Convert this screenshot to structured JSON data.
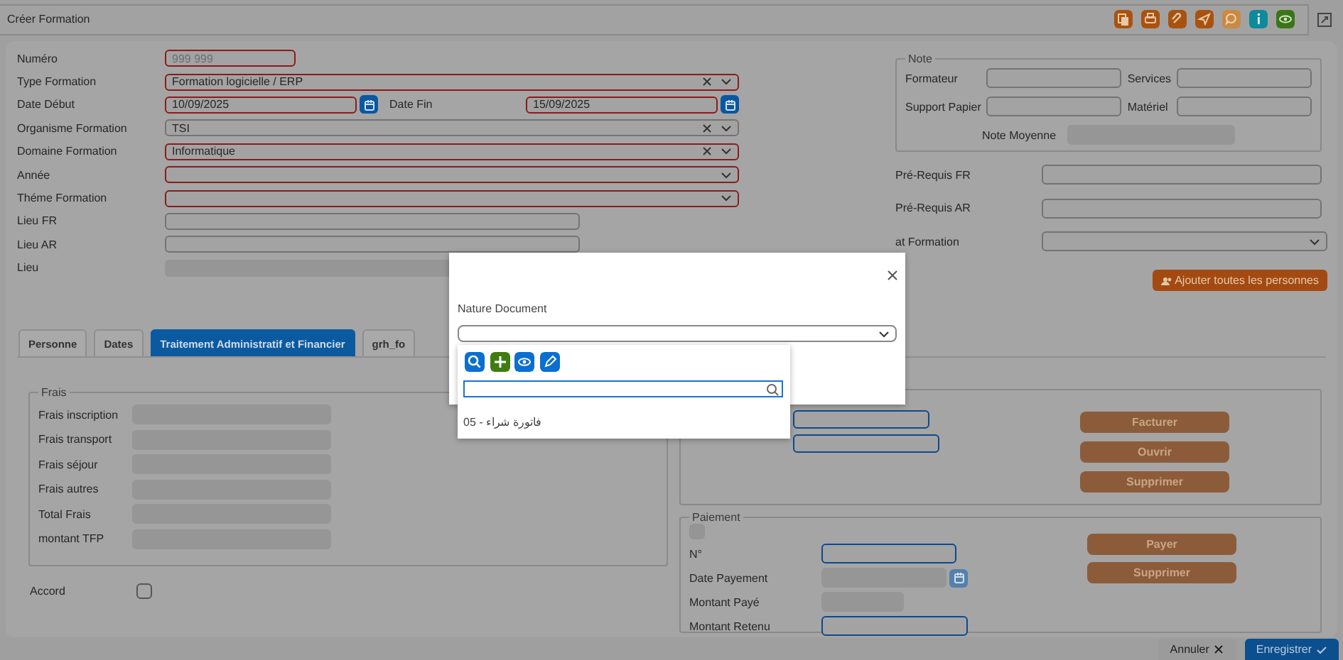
{
  "window": {
    "title": "Créer Formation"
  },
  "toolbar": [
    {
      "kind": "documents"
    },
    {
      "kind": "print"
    },
    {
      "kind": "attach"
    },
    {
      "kind": "send"
    },
    {
      "kind": "comment"
    },
    {
      "kind": "info"
    },
    {
      "kind": "view"
    }
  ],
  "form": [
    {
      "label": "Numéro",
      "kind": "number",
      "placeholder": "999 999",
      "required": true
    },
    {
      "label": "Type Formation",
      "kind": "select",
      "value": "Formation logicielle / ERP",
      "required": true,
      "clearable": true
    },
    {
      "kind": "date_pair",
      "fields": [
        {
          "label": "Date Début",
          "value": "10/09/2025",
          "required": true
        },
        {
          "label": "Date Fin",
          "value": "15/09/2025",
          "required": true
        }
      ]
    },
    {
      "label": "Organisme Formation",
      "kind": "select",
      "value": "TSI",
      "required": false,
      "clearable": true
    },
    {
      "label": "Domaine Formation",
      "kind": "select",
      "value": "Informatique",
      "required": true,
      "clearable": true
    },
    {
      "label": "Année",
      "kind": "select",
      "required": true,
      "clearable": false
    },
    {
      "label": "Théme Formation",
      "kind": "select",
      "required": true,
      "clearable": false
    },
    {
      "label": "Lieu FR",
      "kind": "text",
      "disabled": false
    },
    {
      "label": "Lieu AR",
      "kind": "text",
      "disabled": false
    },
    {
      "label": "Lieu",
      "kind": "text",
      "disabled": true
    }
  ],
  "note": {
    "legend": "Note",
    "fields": [
      {
        "label": "Formateur"
      },
      {
        "label": "Services"
      },
      {
        "label": "Support Papier"
      },
      {
        "label": "Matériel"
      }
    ],
    "average": {
      "label": "Note Moyenne"
    }
  },
  "side_fields": [
    {
      "label": "Pré-Requis FR",
      "kind": "text"
    },
    {
      "label": "Pré-Requis AR",
      "kind": "text"
    },
    {
      "label": "at Formation",
      "kind": "select"
    }
  ],
  "add_all_button": {
    "label": "Ajouter toutes les personnes"
  },
  "tabs": [
    {
      "label": "Personne",
      "selected": false
    },
    {
      "label": "Dates",
      "selected": false
    },
    {
      "label": "Traitement Administratif et Financier",
      "selected": true
    },
    {
      "label": "grh_fo",
      "selected": false
    }
  ],
  "frais": {
    "legend": "Frais",
    "fields": [
      {
        "label": "Frais inscription"
      },
      {
        "label": "Frais transport"
      },
      {
        "label": "Frais séjour"
      },
      {
        "label": "Frais autres"
      },
      {
        "label": "Total Frais"
      },
      {
        "label": "montant TFP"
      }
    ]
  },
  "accord": {
    "label": "Accord",
    "checked": false
  },
  "facture": {
    "buttons": [
      {
        "label": "Facturer"
      },
      {
        "label": "Ouvrir"
      },
      {
        "label": "Supprimer"
      }
    ]
  },
  "paiement": {
    "legend": "Paiement",
    "fields": [
      {
        "label": "N°",
        "kind": "text",
        "disabled": false
      },
      {
        "label": "Date Payement",
        "kind": "date",
        "disabled": true
      },
      {
        "label": "Montant Payé",
        "kind": "text",
        "disabled": true
      },
      {
        "label": "Montant Retenu",
        "kind": "text",
        "disabled": false
      }
    ],
    "buttons": [
      {
        "label": "Payer"
      },
      {
        "label": "Supprimer"
      }
    ]
  },
  "footer": [
    {
      "label": "Annuler",
      "kind": "cancel"
    },
    {
      "label": "Enregistrer",
      "kind": "save"
    }
  ],
  "modal": {
    "label": "Nature Document",
    "actions": [
      {
        "kind": "search"
      },
      {
        "kind": "add"
      },
      {
        "kind": "view"
      },
      {
        "kind": "edit"
      }
    ],
    "options": [
      {
        "label": "فاتورة شراء - 05"
      }
    ]
  }
}
